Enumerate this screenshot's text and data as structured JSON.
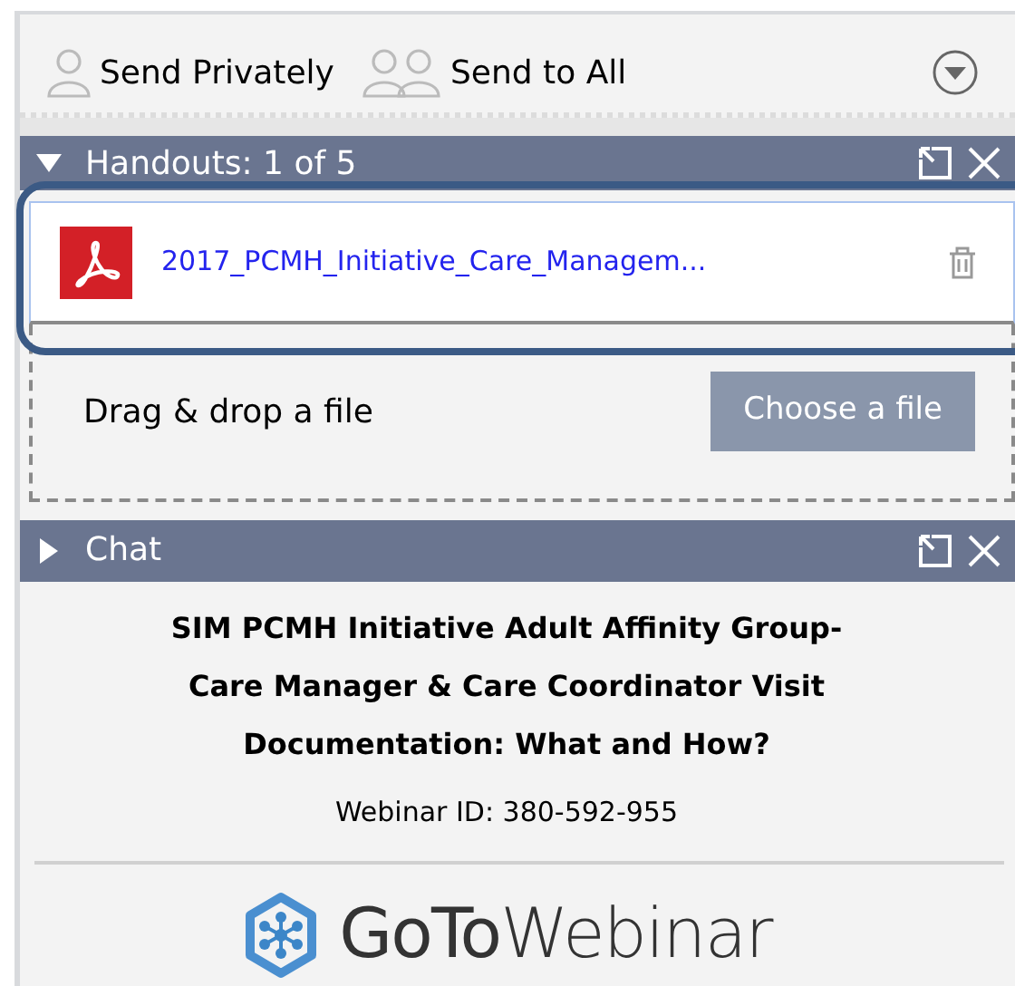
{
  "toolbar": {
    "buttons": [
      {
        "kind": "single",
        "label": "Send Privately"
      },
      {
        "kind": "group",
        "label": "Send to All"
      }
    ]
  },
  "handouts": {
    "title": "Handouts: 1 of 5",
    "expanded": true,
    "files": [
      {
        "name": "2017_PCMH_Initiative_Care_Managem..."
      }
    ],
    "drop_hint": "Drag & drop a file",
    "choose_button": "Choose a file"
  },
  "chat": {
    "title": "Chat",
    "expanded": false
  },
  "webinar": {
    "title_lines": [
      "SIM PCMH Initiative Adult Affinity Group-",
      "Care Manager & Care Coordinator Visit",
      "Documentation: What and How?"
    ],
    "webinar_id": "Webinar ID: 380-592-955",
    "logo": "**GoTo**Webinar"
  }
}
